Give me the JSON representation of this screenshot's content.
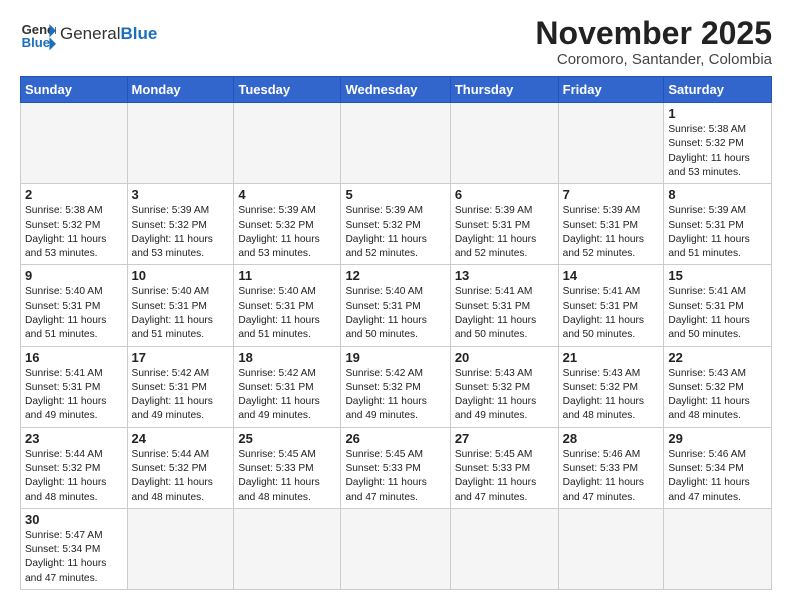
{
  "header": {
    "logo_general": "General",
    "logo_blue": "Blue",
    "month_title": "November 2025",
    "location": "Coromoro, Santander, Colombia"
  },
  "days_of_week": [
    "Sunday",
    "Monday",
    "Tuesday",
    "Wednesday",
    "Thursday",
    "Friday",
    "Saturday"
  ],
  "weeks": [
    [
      {
        "num": "",
        "content": ""
      },
      {
        "num": "",
        "content": ""
      },
      {
        "num": "",
        "content": ""
      },
      {
        "num": "",
        "content": ""
      },
      {
        "num": "",
        "content": ""
      },
      {
        "num": "",
        "content": ""
      },
      {
        "num": "1",
        "content": "Sunrise: 5:38 AM\nSunset: 5:32 PM\nDaylight: 11 hours\nand 53 minutes."
      }
    ],
    [
      {
        "num": "2",
        "content": "Sunrise: 5:38 AM\nSunset: 5:32 PM\nDaylight: 11 hours\nand 53 minutes."
      },
      {
        "num": "3",
        "content": "Sunrise: 5:39 AM\nSunset: 5:32 PM\nDaylight: 11 hours\nand 53 minutes."
      },
      {
        "num": "4",
        "content": "Sunrise: 5:39 AM\nSunset: 5:32 PM\nDaylight: 11 hours\nand 53 minutes."
      },
      {
        "num": "5",
        "content": "Sunrise: 5:39 AM\nSunset: 5:32 PM\nDaylight: 11 hours\nand 52 minutes."
      },
      {
        "num": "6",
        "content": "Sunrise: 5:39 AM\nSunset: 5:31 PM\nDaylight: 11 hours\nand 52 minutes."
      },
      {
        "num": "7",
        "content": "Sunrise: 5:39 AM\nSunset: 5:31 PM\nDaylight: 11 hours\nand 52 minutes."
      },
      {
        "num": "8",
        "content": "Sunrise: 5:39 AM\nSunset: 5:31 PM\nDaylight: 11 hours\nand 51 minutes."
      }
    ],
    [
      {
        "num": "9",
        "content": "Sunrise: 5:40 AM\nSunset: 5:31 PM\nDaylight: 11 hours\nand 51 minutes."
      },
      {
        "num": "10",
        "content": "Sunrise: 5:40 AM\nSunset: 5:31 PM\nDaylight: 11 hours\nand 51 minutes."
      },
      {
        "num": "11",
        "content": "Sunrise: 5:40 AM\nSunset: 5:31 PM\nDaylight: 11 hours\nand 51 minutes."
      },
      {
        "num": "12",
        "content": "Sunrise: 5:40 AM\nSunset: 5:31 PM\nDaylight: 11 hours\nand 50 minutes."
      },
      {
        "num": "13",
        "content": "Sunrise: 5:41 AM\nSunset: 5:31 PM\nDaylight: 11 hours\nand 50 minutes."
      },
      {
        "num": "14",
        "content": "Sunrise: 5:41 AM\nSunset: 5:31 PM\nDaylight: 11 hours\nand 50 minutes."
      },
      {
        "num": "15",
        "content": "Sunrise: 5:41 AM\nSunset: 5:31 PM\nDaylight: 11 hours\nand 50 minutes."
      }
    ],
    [
      {
        "num": "16",
        "content": "Sunrise: 5:41 AM\nSunset: 5:31 PM\nDaylight: 11 hours\nand 49 minutes."
      },
      {
        "num": "17",
        "content": "Sunrise: 5:42 AM\nSunset: 5:31 PM\nDaylight: 11 hours\nand 49 minutes."
      },
      {
        "num": "18",
        "content": "Sunrise: 5:42 AM\nSunset: 5:31 PM\nDaylight: 11 hours\nand 49 minutes."
      },
      {
        "num": "19",
        "content": "Sunrise: 5:42 AM\nSunset: 5:32 PM\nDaylight: 11 hours\nand 49 minutes."
      },
      {
        "num": "20",
        "content": "Sunrise: 5:43 AM\nSunset: 5:32 PM\nDaylight: 11 hours\nand 49 minutes."
      },
      {
        "num": "21",
        "content": "Sunrise: 5:43 AM\nSunset: 5:32 PM\nDaylight: 11 hours\nand 48 minutes."
      },
      {
        "num": "22",
        "content": "Sunrise: 5:43 AM\nSunset: 5:32 PM\nDaylight: 11 hours\nand 48 minutes."
      }
    ],
    [
      {
        "num": "23",
        "content": "Sunrise: 5:44 AM\nSunset: 5:32 PM\nDaylight: 11 hours\nand 48 minutes."
      },
      {
        "num": "24",
        "content": "Sunrise: 5:44 AM\nSunset: 5:32 PM\nDaylight: 11 hours\nand 48 minutes."
      },
      {
        "num": "25",
        "content": "Sunrise: 5:45 AM\nSunset: 5:33 PM\nDaylight: 11 hours\nand 48 minutes."
      },
      {
        "num": "26",
        "content": "Sunrise: 5:45 AM\nSunset: 5:33 PM\nDaylight: 11 hours\nand 47 minutes."
      },
      {
        "num": "27",
        "content": "Sunrise: 5:45 AM\nSunset: 5:33 PM\nDaylight: 11 hours\nand 47 minutes."
      },
      {
        "num": "28",
        "content": "Sunrise: 5:46 AM\nSunset: 5:33 PM\nDaylight: 11 hours\nand 47 minutes."
      },
      {
        "num": "29",
        "content": "Sunrise: 5:46 AM\nSunset: 5:34 PM\nDaylight: 11 hours\nand 47 minutes."
      }
    ],
    [
      {
        "num": "30",
        "content": "Sunrise: 5:47 AM\nSunset: 5:34 PM\nDaylight: 11 hours\nand 47 minutes."
      },
      {
        "num": "",
        "content": ""
      },
      {
        "num": "",
        "content": ""
      },
      {
        "num": "",
        "content": ""
      },
      {
        "num": "",
        "content": ""
      },
      {
        "num": "",
        "content": ""
      },
      {
        "num": "",
        "content": ""
      }
    ]
  ]
}
